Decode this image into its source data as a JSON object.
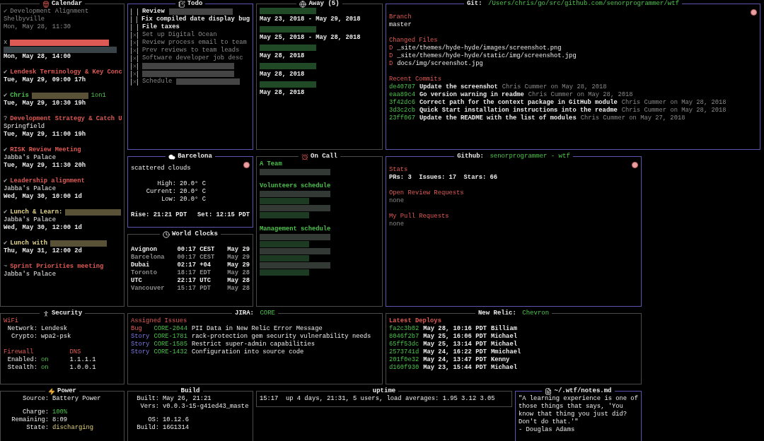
{
  "calendar": {
    "title": "Calendar",
    "focusable": false,
    "events": [
      {
        "status": "✔",
        "title": "Development Alignment",
        "location": "Shelbyville",
        "time": "Mon, May 28, 11:30",
        "kind": "past"
      },
      {
        "status": "x",
        "redacted": true,
        "location_redacted": true,
        "time": "Mon, May 28, 14:00",
        "kind": "upcoming",
        "color": "#e05a55"
      },
      {
        "status": "✔",
        "title": "Lendesk Terminology & Key Conc",
        "time": "Tue, May 29, 09:00 17h",
        "kind": "upcoming",
        "color": "#e05a55"
      },
      {
        "status": "✔",
        "title": "Chris",
        "redacted": true,
        "title_suffix": "1on1",
        "time": "Tue, May 29, 10:30 19h",
        "kind": "upcoming",
        "color": "#4cc24c"
      },
      {
        "status": "?",
        "title": "Development Strategy & Catch U",
        "location": "Springfield",
        "time": "Tue, May 29, 11:00 19h",
        "kind": "upcoming",
        "color": "#e05a55"
      },
      {
        "status": "✔",
        "title": "RISK Review Meeting",
        "location": "Jabba's Palace",
        "time": "Tue, May 29, 11:30 20h",
        "kind": "upcoming",
        "color": "#e05a55"
      },
      {
        "status": "✔",
        "title": "Leadership alignment",
        "location": "Jabba's Palace",
        "time": "Wed, May 30, 10:00 1d",
        "kind": "upcoming",
        "color": "#e05a55"
      },
      {
        "status": "✔",
        "title": "Lunch & Learn:",
        "redacted": true,
        "location": "Jabba's Palace",
        "time": "Wed, May 30, 12:00 1d",
        "kind": "upcoming",
        "color": "#e8d88a"
      },
      {
        "status": "✔",
        "title": "Lunch with",
        "redacted": true,
        "time": "Thu, May 31, 12:00 2d",
        "kind": "upcoming",
        "color": "#e8d88a"
      },
      {
        "status": "~",
        "title": "Sprint Priorities meeting",
        "location": "Jabba's Palace",
        "kind": "upcoming",
        "color": "#e05a55"
      }
    ]
  },
  "todo": {
    "title": "Todo",
    "focusable": true,
    "items": [
      {
        "text": "Review",
        "redacted": true,
        "checked": false
      },
      {
        "text": "Fix compiled date display bug",
        "checked": false
      },
      {
        "text": "File taxes",
        "checked": false
      },
      {
        "text": "Set up Digital Ocean",
        "checked": true
      },
      {
        "text": "Review process email to team",
        "checked": true
      },
      {
        "text": "Prev reviews to team leads",
        "checked": true
      },
      {
        "text": "Software developer job desc",
        "checked": true
      },
      {
        "redacted": true,
        "checked": true
      },
      {
        "redacted": true,
        "checked": true
      },
      {
        "text": "Schedule",
        "redacted": true,
        "checked": true
      }
    ]
  },
  "away": {
    "title": "Away (5)",
    "focusable": false,
    "entries": [
      {
        "dates": "May 23, 2018 - May 29, 2018"
      },
      {
        "dates": "May 25, 2018 - May 28, 2018"
      },
      {
        "dates": "May 28, 2018"
      },
      {
        "dates": "May 28, 2018"
      },
      {
        "dates": "May 28, 2018"
      }
    ]
  },
  "git": {
    "title": "Git: ",
    "title_highlight": "/Users/chris/go/src/github.com/senorprogrammer/wtf",
    "focusable": true,
    "branch_heading": "Branch",
    "branch": "master",
    "files_heading": "Changed Files",
    "files": [
      {
        "status": "D",
        "path": "_site/themes/hyde-hyde/images/screenshot.png"
      },
      {
        "status": "D",
        "path": "_site/themes/hyde-hyde/static/img/screenshot.jpg"
      },
      {
        "status": "D",
        "path": "docs/img/screenshot.jpg"
      }
    ],
    "commits_heading": "Recent Commits",
    "commits": [
      {
        "sha": "de40787",
        "message": "Update the screenshot",
        "author": "Chris Cummer on May 28, 2018"
      },
      {
        "sha": "eaa89c4",
        "message": "Go version warning in readme",
        "author": "Chris Cummer on May 28, 2018"
      },
      {
        "sha": "3f42dc6",
        "message": "Correct path for the context package in GitHub module",
        "author": "Chris Cummer on May 28, 2018"
      },
      {
        "sha": "3d3c2cb",
        "message": "Quick Start installation instructions into the readme",
        "author": "Chris Cummer on May 28, 2018"
      },
      {
        "sha": "23ff067",
        "message": "Update the README with the list of modules",
        "author": "Chris Cummer on May 27, 2018"
      }
    ]
  },
  "weather": {
    "title": "Barcelona",
    "focusable": true,
    "description": "scattered clouds",
    "temps": [
      {
        "label": "High:",
        "value": "20.0° C"
      },
      {
        "label": "Current:",
        "value": "20.0° C"
      },
      {
        "label": "Low:",
        "value": "20.0° C"
      }
    ],
    "rise": "Rise: 21:21 PDT",
    "set": "Set: 12:15 PDT"
  },
  "on_call": {
    "title": "On Call",
    "focusable": false,
    "groups": [
      {
        "name": "A Team",
        "members": [
          {
            "redacted": true
          }
        ]
      },
      {
        "name": "Volunteers schedule",
        "members": [
          {
            "redacted": true
          },
          {
            "redacted": true
          },
          {
            "redacted": true
          },
          {
            "redacted": true
          }
        ]
      },
      {
        "name": "Management schedule",
        "members": [
          {
            "redacted": true
          },
          {
            "redacted": true
          },
          {
            "redacted": true
          },
          {
            "redacted": true
          },
          {
            "redacted": true
          },
          {
            "redacted": true
          }
        ]
      }
    ]
  },
  "github": {
    "title": "Github: ",
    "title_highlight": "senorprogrammer - wtf",
    "focusable": true,
    "stats_heading": "Stats",
    "stats": "PRs: 3  Issues: 17  Stars: 66",
    "sections": [
      {
        "heading": "Open Review Requests",
        "value": "none"
      },
      {
        "heading": "My Pull Requests",
        "value": "none"
      }
    ]
  },
  "world_clocks": {
    "title": "World Clocks",
    "focusable": false,
    "clocks": [
      {
        "city": "Avignon",
        "time": "00:17 CEST",
        "date": "May 29"
      },
      {
        "city": "Barcelona",
        "time": "00:17 CEST",
        "date": "May 29"
      },
      {
        "city": "Dubai",
        "time": "02:17 +04",
        "date": "May 29"
      },
      {
        "city": "Toronto",
        "time": "18:17 EDT",
        "date": "May 28"
      },
      {
        "city": "UTC",
        "time": "22:17 UTC",
        "date": "May 28"
      },
      {
        "city": "Vancouver",
        "time": "15:17 PDT",
        "date": "May 28"
      }
    ]
  },
  "security": {
    "title": "Security",
    "focusable": false,
    "wifi_heading": "WiFi",
    "wifi": [
      {
        "label": "Network:",
        "value": "Lendesk"
      },
      {
        "label": "Crypto:",
        "value": "wpa2-psk"
      }
    ],
    "firewall_heading": "Firewall",
    "firewall": [
      {
        "label": "Enabled:",
        "value": "on"
      },
      {
        "label": "Stealth:",
        "value": "on"
      }
    ],
    "dns_heading": "DNS",
    "dns": [
      "1.1.1.1",
      "1.0.0.1"
    ]
  },
  "jira": {
    "title": "JIRA: ",
    "title_highlight": "CORE",
    "focusable": false,
    "heading": "Assigned Issues",
    "issues": [
      {
        "type": "Bug",
        "kind": "bug",
        "key": "CORE-2044",
        "summary": "PII Data in New Relic Error Message"
      },
      {
        "type": "Story",
        "kind": "story",
        "key": "CORE-1781",
        "summary": "rack-protection gem security vulnerability needs"
      },
      {
        "type": "Story",
        "kind": "story",
        "key": "CORE-1585",
        "summary": "Restrict super-admin capabilities"
      },
      {
        "type": "Story",
        "kind": "story",
        "key": "CORE-1432",
        "summary": "Configuration into source code"
      }
    ]
  },
  "new_relic": {
    "title": "New Relic: ",
    "title_highlight": "Chevron",
    "focusable": false,
    "heading": "Latest Deploys",
    "deploys": [
      {
        "sha": "fa2c3b02",
        "time": "May 28, 10:16 PDT",
        "user": "Billiam"
      },
      {
        "sha": "8046f2b7",
        "time": "May 25, 16:06 PDT",
        "user": "Michael"
      },
      {
        "sha": "65ff53dc",
        "time": "May 25, 13:14 PDT",
        "user": "Michael"
      },
      {
        "sha": "2573741d",
        "time": "May 24, 16:22 PDT",
        "user": "Mmichael"
      },
      {
        "sha": "201f0e32",
        "time": "May 24, 13:47 PDT",
        "user": "Kenny"
      },
      {
        "sha": "d160f930",
        "time": "May 23, 15:44 PDT",
        "user": "Michael"
      }
    ]
  },
  "power": {
    "title": "Power",
    "focusable": false,
    "rows": [
      {
        "label": "Source:",
        "value": "Battery Power",
        "kind": "plain"
      },
      {
        "label": "Charge:",
        "value": "100%",
        "kind": "good"
      },
      {
        "label": "Remaining:",
        "value": "8:09",
        "kind": "plain"
      },
      {
        "label": "State:",
        "value": "discharging",
        "kind": "warn"
      }
    ]
  },
  "build": {
    "title": "Build",
    "focusable": false,
    "rows": [
      {
        "label": "Built:",
        "value": "May 26, 21:21"
      },
      {
        "label": "Vers:",
        "value": "v0.0.3-15-g41ed43_maste"
      },
      {
        "label": "OS:",
        "value": "10.12.6"
      },
      {
        "label": "Build:",
        "value": "16G1314"
      }
    ]
  },
  "uptime": {
    "title": "uptime",
    "focusable": false,
    "text": "15:17  up 4 days, 21:31, 5 users, load averages: 1.95 3.12 3.05"
  },
  "notes": {
    "title": "~/.wtf/notes.md",
    "focusable": true,
    "quote": "\"A learning experience is one of those things that says, 'You know that thing you just did? Don't do that.'\"",
    "author": "- Douglas Adams"
  }
}
